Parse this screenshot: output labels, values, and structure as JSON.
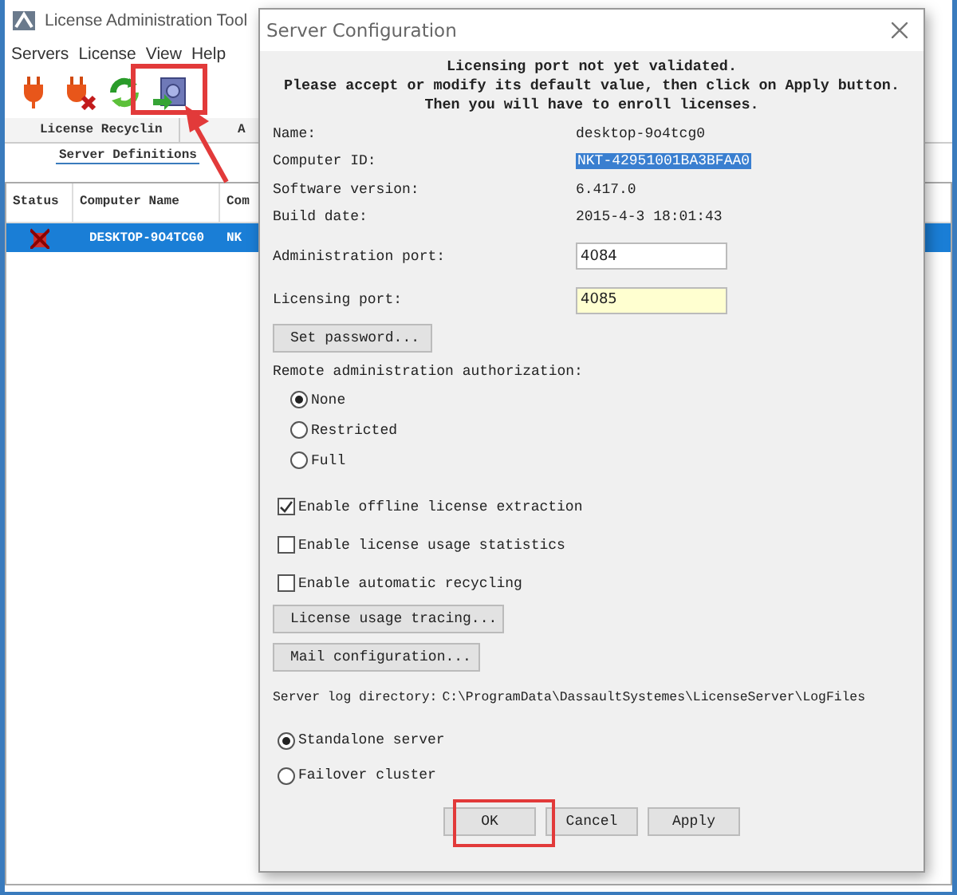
{
  "main_window": {
    "title": "License Administration Tool",
    "menu": [
      "Servers",
      "License",
      "View",
      "Help"
    ],
    "tabs": [
      {
        "label": "License Recyclin",
        "selected": false
      },
      {
        "label": "A",
        "selected": false
      }
    ],
    "subtabs": [
      {
        "label": "Server Definitions",
        "selected": true
      }
    ],
    "table": {
      "columns": [
        "Status",
        "Computer Name",
        "Com"
      ],
      "rows": [
        {
          "computer_name": "DESKTOP-9O4TCG0",
          "column_3": "NK",
          "selected": true
        }
      ]
    }
  },
  "dialog": {
    "title": "Server Configuration",
    "message": [
      "Licensing port not yet validated.",
      "Please accept or modify its default value, then click on Apply button.",
      "Then you will have to enroll licenses."
    ],
    "info": [
      {
        "label": "Name:",
        "value": "desktop-9o4tcg0",
        "selected": false
      },
      {
        "label": "Computer ID:",
        "value": "NKT-42951001BA3BFAA0",
        "selected": true
      },
      {
        "label": "Software version:",
        "value": "6.417.0",
        "selected": false
      },
      {
        "label": "Build date:",
        "value": "2015-4-3 18:01:43",
        "selected": false
      }
    ],
    "ports": [
      {
        "label": "Administration port:",
        "value": "4084",
        "highlighted": false
      },
      {
        "label": "Licensing port:",
        "value": "4085",
        "highlighted": true
      }
    ],
    "set_password_button": "Set password...",
    "remote_auth": {
      "label": "Remote administration authorization:",
      "options": [
        {
          "label": "None",
          "selected": true
        },
        {
          "label": "Restricted",
          "selected": false
        },
        {
          "label": "Full",
          "selected": false
        }
      ]
    },
    "checkboxes": [
      {
        "label": "Enable offline license extraction",
        "checked": true
      },
      {
        "label": "Enable license usage statistics",
        "checked": false
      },
      {
        "label": "Enable automatic recycling",
        "checked": false
      }
    ],
    "license_tracing_button": "License usage tracing...",
    "mail_button": "Mail configuration...",
    "log_directory": {
      "label": "Server log directory:",
      "value": "C:\\ProgramData\\DassaultSystemes\\LicenseServer\\LogFiles"
    },
    "server_mode": [
      {
        "label": "Standalone server",
        "selected": true
      },
      {
        "label": "Failover cluster",
        "selected": false
      }
    ],
    "buttons": [
      "OK",
      "Cancel",
      "Apply"
    ]
  }
}
